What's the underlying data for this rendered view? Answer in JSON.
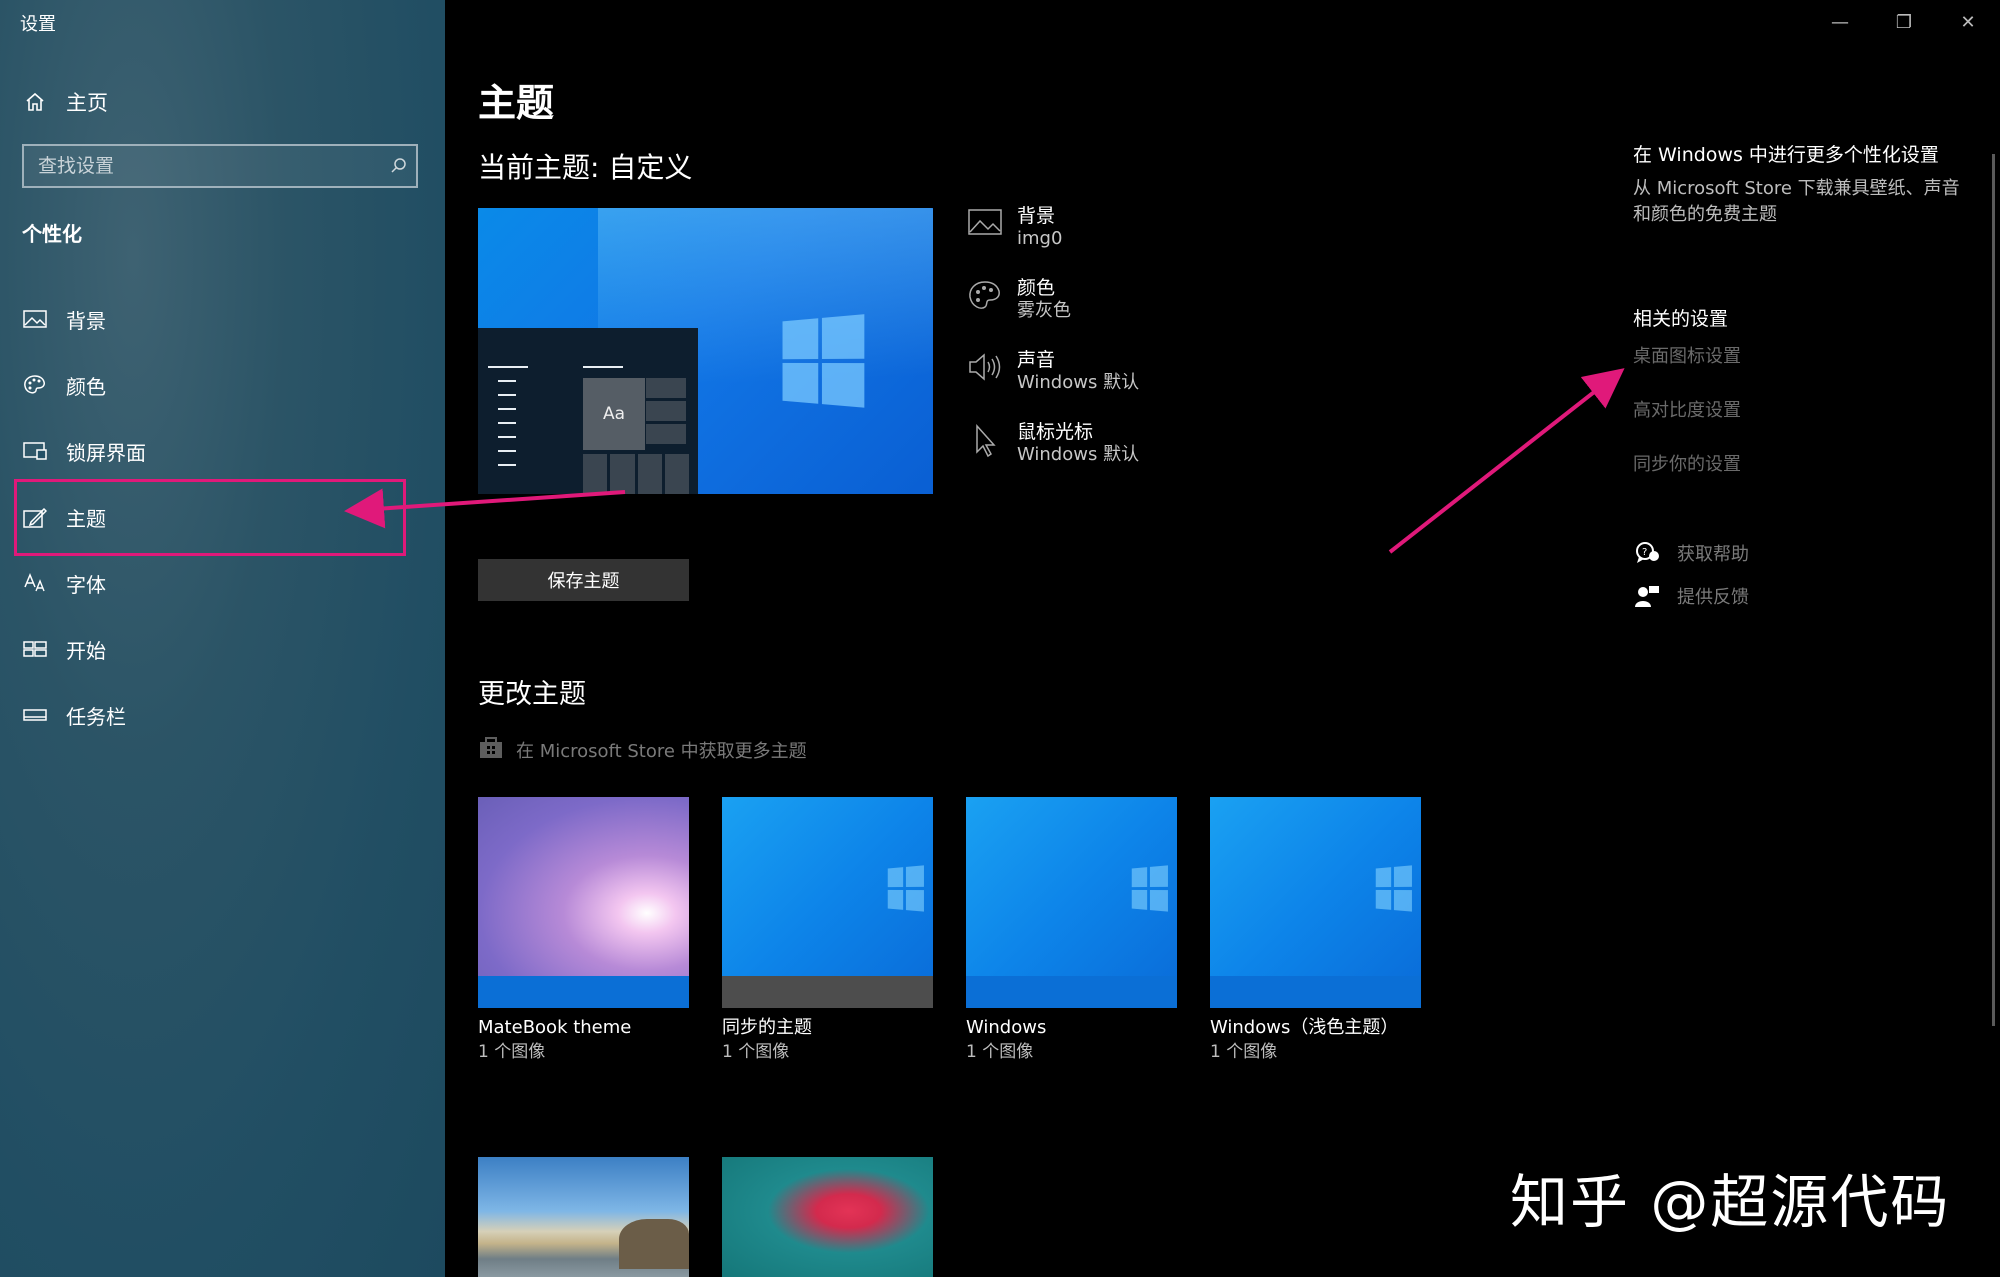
{
  "window": {
    "title": "设置",
    "controls": {
      "minimize": "—",
      "restore": "❐",
      "close": "✕"
    }
  },
  "sidebar": {
    "home_label": "主页",
    "search_placeholder": "查找设置",
    "section_title": "个性化",
    "items": [
      {
        "label": "背景",
        "icon": "picture-icon"
      },
      {
        "label": "颜色",
        "icon": "palette-icon"
      },
      {
        "label": "锁屏界面",
        "icon": "lock-screen-icon"
      },
      {
        "label": "主题",
        "icon": "theme-brush-icon",
        "selected": true
      },
      {
        "label": "字体",
        "icon": "font-icon"
      },
      {
        "label": "开始",
        "icon": "start-icon"
      },
      {
        "label": "任务栏",
        "icon": "taskbar-icon"
      }
    ]
  },
  "main": {
    "page_title": "主题",
    "current_theme": "当前主题: 自定义",
    "preview_aa": "Aa",
    "properties": [
      {
        "name": "背景",
        "value": "img0",
        "icon": "picture-icon"
      },
      {
        "name": "颜色",
        "value": "雾灰色",
        "icon": "palette-icon"
      },
      {
        "name": "声音",
        "value": "Windows 默认",
        "icon": "speaker-icon"
      },
      {
        "name": "鼠标光标",
        "value": "Windows 默认",
        "icon": "cursor-icon"
      }
    ],
    "save_button": "保存主题",
    "change_title": "更改主题",
    "store_link": "在 Microsoft Store 中获取更多主题",
    "themes": [
      {
        "name": "MateBook theme",
        "count": "1 个图像"
      },
      {
        "name": "同步的主题",
        "count": "1 个图像"
      },
      {
        "name": "Windows",
        "count": "1 个图像"
      },
      {
        "name": "Windows（浅色主题）",
        "count": "1 个图像"
      }
    ]
  },
  "right": {
    "title": "在 Windows 中进行更多个性化设置",
    "description": "从 Microsoft Store 下载兼具壁纸、声音和颜色的免费主题",
    "related_title": "相关的设置",
    "links": [
      "桌面图标设置",
      "高对比度设置",
      "同步你的设置"
    ],
    "help": "获取帮助",
    "feedback": "提供反馈"
  },
  "watermark": "知乎 @超源代码",
  "colors": {
    "accent": "#e0197a",
    "sidebar": "#235066"
  }
}
